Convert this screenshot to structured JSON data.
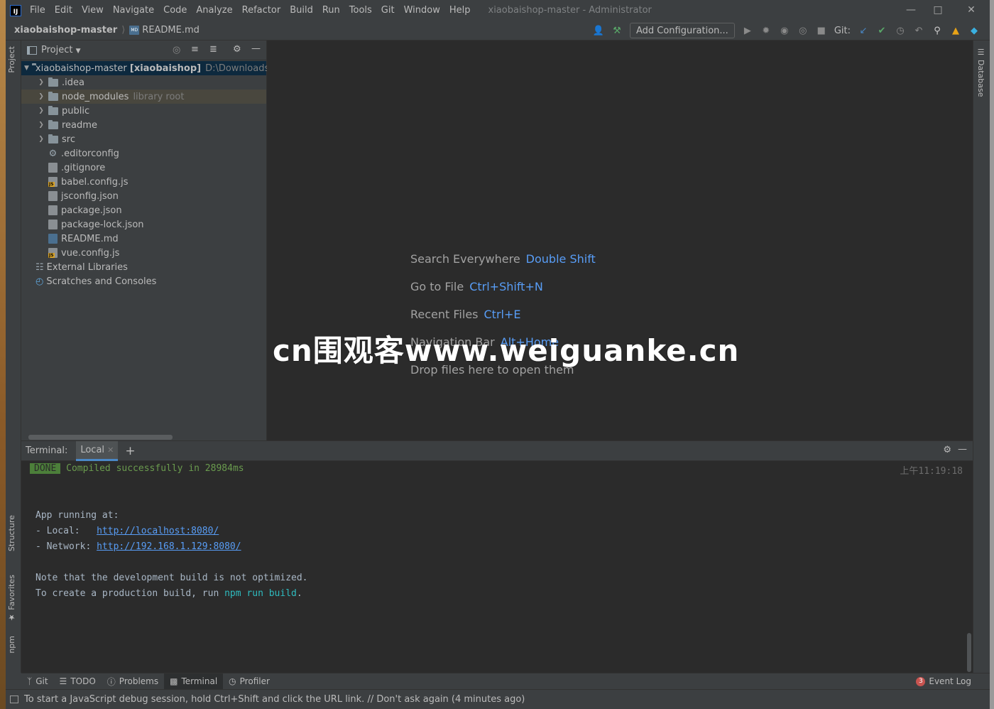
{
  "titlebar": {
    "app_icon": "IJ",
    "menu": [
      "File",
      "Edit",
      "View",
      "Navigate",
      "Code",
      "Analyze",
      "Refactor",
      "Build",
      "Run",
      "Tools",
      "Git",
      "Window",
      "Help"
    ],
    "window_title": "xiaobaishop-master - Administrator"
  },
  "navbar": {
    "project": "xiaobaishop-master",
    "file": "README.md",
    "md_icon_text": "MD",
    "add_configuration": "Add Configuration...",
    "git_label": "Git:"
  },
  "left_strip": {
    "project": "Project",
    "structure": "Structure",
    "favorites": "Favorites",
    "npm": "npm"
  },
  "right_strip": {
    "database": "Database"
  },
  "project_panel": {
    "title": "Project",
    "root": {
      "name": "xiaobaishop-master",
      "module": "[xiaobaishop]",
      "path": "D:\\Downloads\\x"
    },
    "items": [
      {
        "name": ".idea",
        "type": "folder"
      },
      {
        "name": "node_modules",
        "type": "folder",
        "note": "library root"
      },
      {
        "name": "public",
        "type": "folder"
      },
      {
        "name": "readme",
        "type": "folder"
      },
      {
        "name": "src",
        "type": "folder"
      },
      {
        "name": ".editorconfig",
        "type": "config"
      },
      {
        "name": ".gitignore",
        "type": "file"
      },
      {
        "name": "babel.config.js",
        "type": "js"
      },
      {
        "name": "jsconfig.json",
        "type": "file"
      },
      {
        "name": "package.json",
        "type": "file"
      },
      {
        "name": "package-lock.json",
        "type": "file"
      },
      {
        "name": "README.md",
        "type": "md"
      },
      {
        "name": "vue.config.js",
        "type": "js"
      }
    ],
    "external_libraries": "External Libraries",
    "scratches": "Scratches and Consoles"
  },
  "editor": {
    "hints": [
      {
        "label": "Search Everywhere",
        "key": "Double Shift"
      },
      {
        "label": "Go to File",
        "key": "Ctrl+Shift+N"
      },
      {
        "label": "Recent Files",
        "key": "Ctrl+E"
      },
      {
        "label": "Navigation Bar",
        "key": "Alt+Home"
      },
      {
        "label": "Drop files here to open them",
        "key": ""
      }
    ],
    "watermark": "cn围观客www.weiguanke.cn"
  },
  "terminal": {
    "label": "Terminal:",
    "tab": "Local",
    "done": "DONE",
    "compiled": "Compiled successfully in 28984ms",
    "time": "上午11:19:18",
    "app_running": "App running at:",
    "local_label": "- Local:   ",
    "local_url": "http://localhost:8080/",
    "network_label": "- Network: ",
    "network_url": "http://192.168.1.129:8080/",
    "note1": "Note that the development build is not optimized.",
    "note2_prefix": "To create a production build, run ",
    "note2_cmd": "npm run build",
    "note2_suffix": "."
  },
  "bottom_tabs": [
    {
      "label": "Git",
      "icon": "git-icon"
    },
    {
      "label": "TODO",
      "icon": "todo-icon"
    },
    {
      "label": "Problems",
      "icon": "problems-icon"
    },
    {
      "label": "Terminal",
      "icon": "terminal-icon"
    },
    {
      "label": "Profiler",
      "icon": "profiler-icon"
    }
  ],
  "event_log": {
    "count": "3",
    "label": "Event Log"
  },
  "statusbar": {
    "message": "To start a JavaScript debug session, hold Ctrl+Shift and click the URL link. // Don't ask again (4 minutes ago)"
  }
}
